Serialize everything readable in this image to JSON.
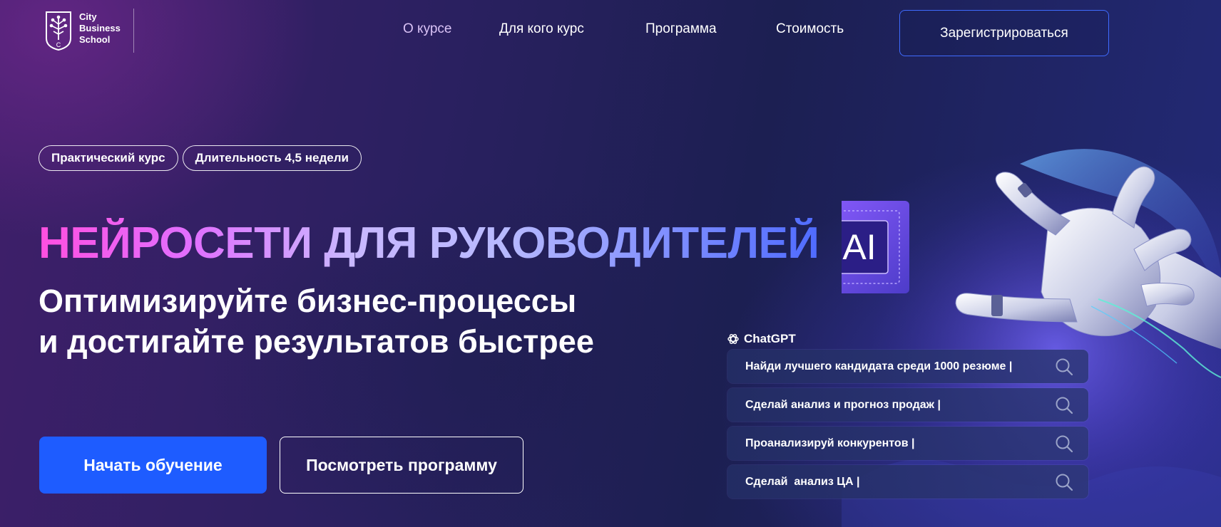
{
  "logo": {
    "line1": "City",
    "line2": "Business",
    "line3": "School",
    "emblem_letter": "C"
  },
  "nav": {
    "items": [
      {
        "label": "О курсе",
        "active": true
      },
      {
        "label": "Для кого курс",
        "active": false
      },
      {
        "label": "Программа",
        "active": false
      },
      {
        "label": "Стоимость",
        "active": false
      }
    ],
    "register_label": "Зарегистрироваться"
  },
  "tags": [
    "Практический курс",
    "Длительность 4,5 недели"
  ],
  "hero": {
    "headline": "НЕЙРОСЕТИ ДЛЯ РУКОВОДИТЕЛЕЙ",
    "subline1": "Оптимизируйте бизнес-процессы",
    "subline2": "и достигайте результатов быстрее",
    "chip_label": "AI"
  },
  "buttons": {
    "primary": "Начать обучение",
    "secondary": "Посмотреть программу"
  },
  "chatgpt": {
    "label": "ChatGPT",
    "prompts": [
      "Найди лучшего кандидата среди 1000 резюме |",
      "Сделай анализ и прогноз продаж |",
      "Проанализируй конкурентов |",
      "Сделай  анализ ЦА |"
    ]
  },
  "colors": {
    "accent_blue": "#1e5cff",
    "nav_active": "#d9c2f5",
    "gradient_start": "#ff4fe0",
    "gradient_end": "#4f6bff"
  }
}
